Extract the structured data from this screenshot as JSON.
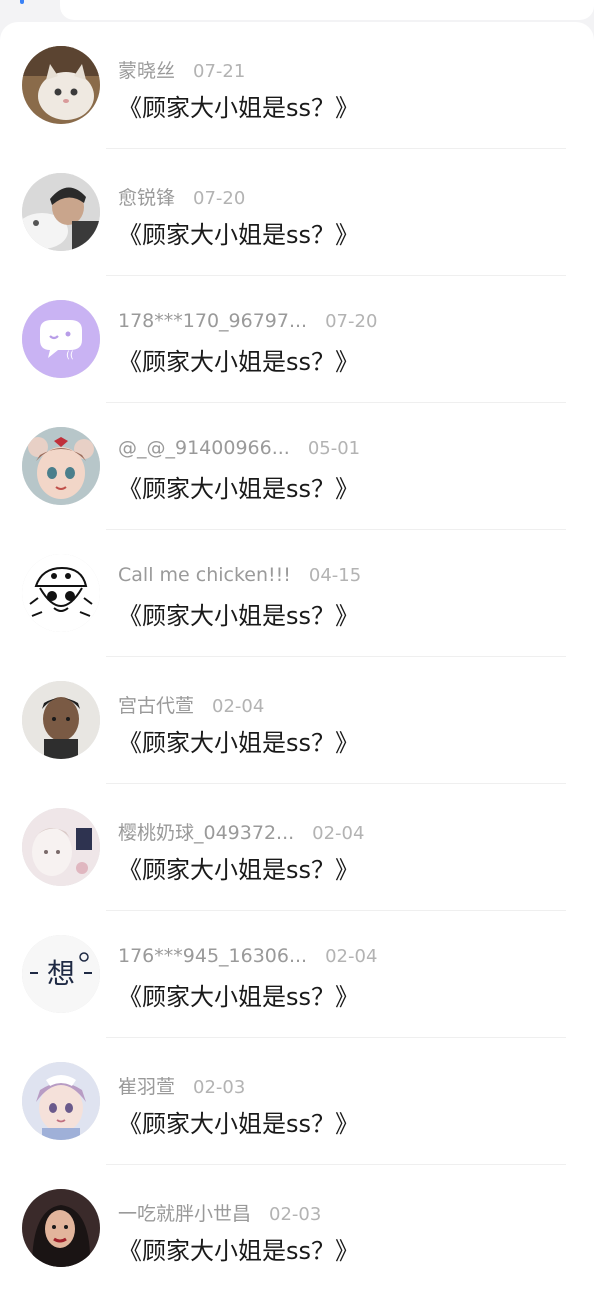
{
  "messages": [
    {
      "name": "蒙晓丝",
      "date": "07-21",
      "text": "《顾家大小姐是ss？》",
      "avatar": "cat-photo-avatar"
    },
    {
      "name": "愈锐锋",
      "date": "07-20",
      "text": "《顾家大小姐是ss？》",
      "avatar": "man-photo-avatar"
    },
    {
      "name": "178***170_96797...",
      "date": "07-20",
      "text": "《顾家大小姐是ss？》",
      "avatar": "chat-bubble-avatar"
    },
    {
      "name": "@_@_91400966...",
      "date": "05-01",
      "text": "《顾家大小姐是ss？》",
      "avatar": "anime-girl-avatar"
    },
    {
      "name": "Call me chicken!!!",
      "date": "04-15",
      "text": "《顾家大小姐是ss？》",
      "avatar": "sketch-character-avatar"
    },
    {
      "name": "宫古代萱",
      "date": "02-04",
      "text": "《顾家大小姐是ss？》",
      "avatar": "boy-photo-avatar"
    },
    {
      "name": "樱桃奶球_049372...",
      "date": "02-04",
      "text": "《顾家大小姐是ss？》",
      "avatar": "pastel-illustration-avatar"
    },
    {
      "name": "176***945_16306...",
      "date": "02-04",
      "text": "《顾家大小姐是ss？》",
      "avatar": "xiang-character-avatar",
      "avatar_glyph": "想"
    },
    {
      "name": "崔羽萱",
      "date": "02-03",
      "text": "《顾家大小姐是ss？》",
      "avatar": "anime-princess-avatar"
    },
    {
      "name": "一吃就胖小世昌",
      "date": "02-03",
      "text": "《顾家大小姐是ss？》",
      "avatar": "woman-photo-avatar"
    }
  ]
}
